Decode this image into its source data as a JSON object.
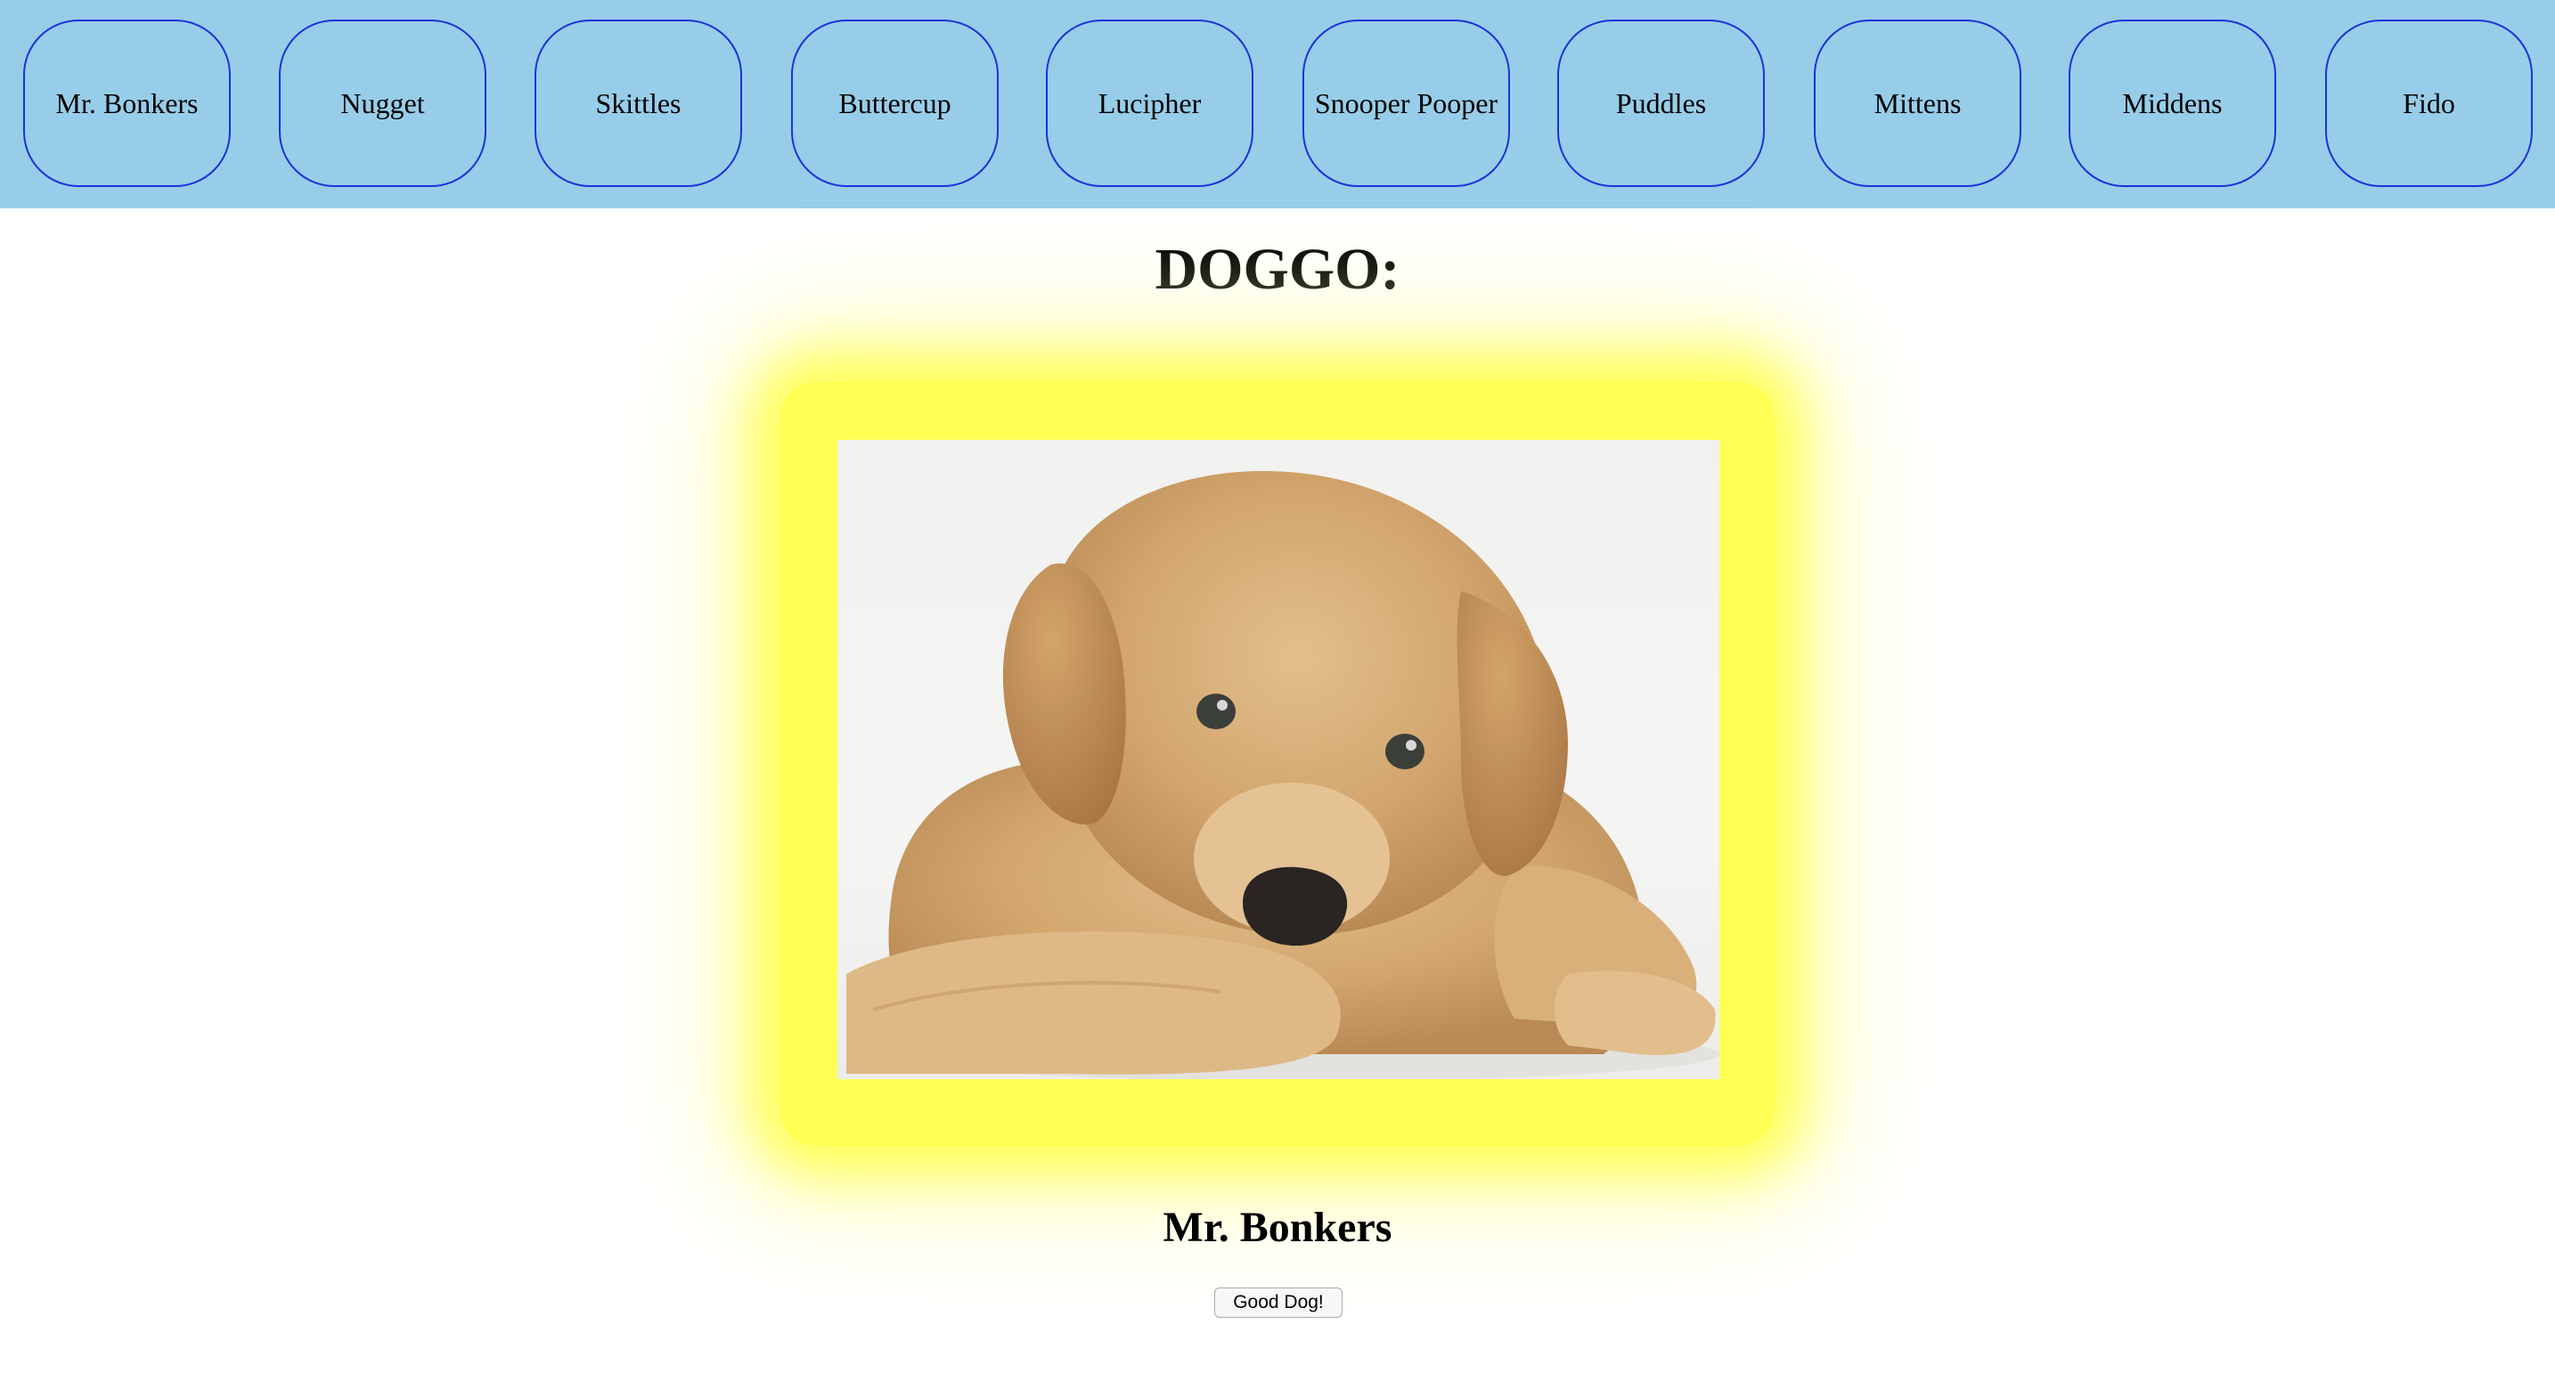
{
  "nav": {
    "buttons": [
      {
        "label": "Mr. Bonkers"
      },
      {
        "label": "Nugget"
      },
      {
        "label": "Skittles"
      },
      {
        "label": "Buttercup"
      },
      {
        "label": "Lucipher"
      },
      {
        "label": "Snooper Pooper"
      },
      {
        "label": "Puddles"
      },
      {
        "label": "Mittens"
      },
      {
        "label": "Middens"
      },
      {
        "label": "Fido"
      }
    ]
  },
  "main": {
    "heading": "DOGGO:",
    "dog_name": "Mr. Bonkers",
    "good_dog_button": "Good Dog!"
  },
  "colors": {
    "nav_background": "#97cde9",
    "button_border": "#1a33d9",
    "glow": "#ffff55"
  }
}
